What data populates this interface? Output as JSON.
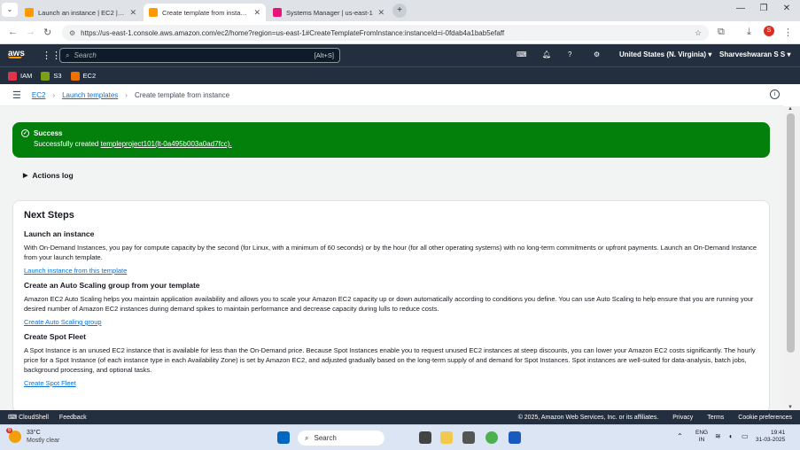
{
  "browser": {
    "tabs": [
      {
        "label": "Launch an instance | EC2 | us-e",
        "active": false,
        "color": "#ff9900"
      },
      {
        "label": "Create template from instance |",
        "active": true,
        "color": "#ff9900"
      },
      {
        "label": "Systems Manager | us-east-1",
        "active": false,
        "color": "#e7157b"
      }
    ],
    "url": "https://us-east-1.console.aws.amazon.com/ec2/home?region=us-east-1#CreateTemplateFromInstance:instanceId=i-0fdab4a1bab5efaff",
    "profile_initial": "S"
  },
  "awsnav": {
    "logo": "aws",
    "search_placeholder": "Search",
    "search_shortcut": "[Alt+S]",
    "region": "United States (N. Virginia)",
    "user": "Sharveshwaran S S"
  },
  "favorites": [
    {
      "label": "IAM",
      "color": "#dd344c"
    },
    {
      "label": "S3",
      "color": "#7aa116"
    },
    {
      "label": "EC2",
      "color": "#ed7100"
    }
  ],
  "breadcrumb": {
    "items": [
      "EC2",
      "Launch templates"
    ],
    "current": "Create template from instance"
  },
  "flash": {
    "title": "Success",
    "prefix": "Successfully created ",
    "link": "templeproject101(lt-0a495b003a0ad7fcc).",
    "color": "#037f0c"
  },
  "actions_log": "Actions log",
  "next_steps": {
    "title": "Next Steps",
    "steps": [
      {
        "heading": "Launch an instance",
        "body": "With On-Demand Instances, you pay for compute capacity by the second (for Linux, with a minimum of 60 seconds) or by the hour (for all other operating systems) with no long-term commitments or upfront payments. Launch an On-Demand Instance from your launch template.",
        "link": "Launch instance from this template"
      },
      {
        "heading": "Create an Auto Scaling group from your template",
        "body": "Amazon EC2 Auto Scaling helps you maintain application availability and allows you to scale your Amazon EC2 capacity up or down automatically according to conditions you define. You can use Auto Scaling to help ensure that you are running your desired number of Amazon EC2 instances during demand spikes to maintain performance and decrease capacity during lulls to reduce costs.",
        "link": "Create Auto Scaling group"
      },
      {
        "heading": "Create Spot Fleet",
        "body": "A Spot Instance is an unused EC2 instance that is available for less than the On-Demand price. Because Spot Instances enable you to request unused EC2 instances at steep discounts, you can lower your Amazon EC2 costs significantly. The hourly price for a Spot Instance (of each instance type in each Availability Zone) is set by Amazon EC2, and adjusted gradually based on the long-term supply of and demand for Spot Instances. Spot instances are well-suited for data-analysis, batch jobs, background processing, and optional tasks.",
        "link": "Create Spot Fleet"
      }
    ]
  },
  "footer": {
    "cloudshell": "CloudShell",
    "feedback": "Feedback",
    "copyright": "© 2025, Amazon Web Services, Inc. or its affiliates.",
    "privacy": "Privacy",
    "terms": "Terms",
    "cookies": "Cookie preferences"
  },
  "taskbar": {
    "weather_temp": "33°C",
    "weather_desc": "Mostly clear",
    "weather_badge": "6",
    "search": "Search",
    "lang_top": "ENG",
    "lang_bottom": "IN",
    "time": "19:41",
    "date": "31-03-2025"
  }
}
